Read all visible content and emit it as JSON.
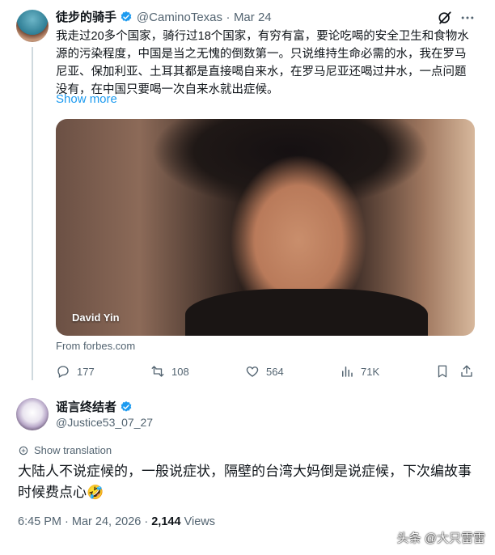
{
  "tweet": {
    "author_name": "徒步的骑手",
    "handle": "@CaminoTexas",
    "separator": "·",
    "date": "Mar 24",
    "text": "我走过20多个国家，骑行过18个国家，有穷有富，要论吃喝的安全卫生和食物水源的污染程度，中国是当之无愧的倒数第一。只说维持生命必需的水，我在罗马尼亚、保加利亚、土耳其都是直接喝自来水，在罗马尼亚还喝过井水，一点问题没有，在中国只要喝一次自来水就出症候。",
    "show_more": "Show more",
    "media_label": "David Yin",
    "media_source": "From forbes.com",
    "stats": {
      "replies": "177",
      "retweets": "108",
      "likes": "564",
      "views": "71K"
    }
  },
  "reply": {
    "author_name": "谣言终结者",
    "handle": "@Justice53_07_27",
    "show_translation": "Show translation",
    "text": "大陆人不说症候的，一般说症状，隔壁的台湾大妈倒是说症候，下次编故事时候费点心🤣",
    "time": "6:45 PM",
    "date": "Mar 24, 2026",
    "views_count": "2,144",
    "views_label": "Views"
  },
  "watermark": "头条 @大只雷雷",
  "colors": {
    "accent": "#1d9bf0",
    "muted": "#536471",
    "text": "#0f1419"
  }
}
